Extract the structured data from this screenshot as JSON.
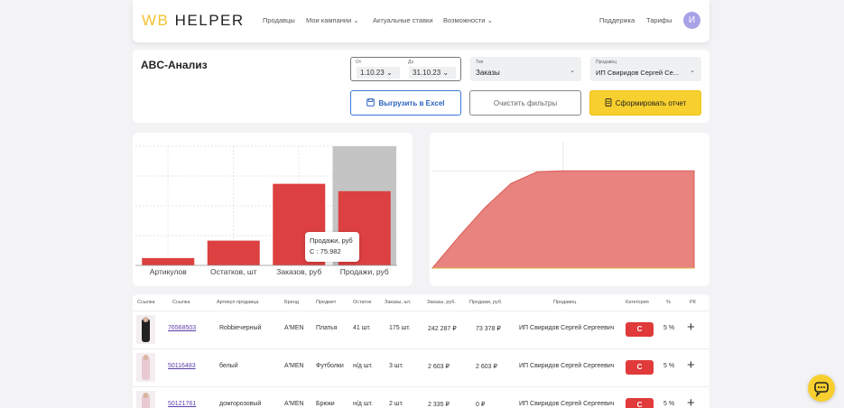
{
  "header": {
    "logo_wb": "WB",
    "logo_helper": "HELPER",
    "nav": [
      "Продавцы",
      "Мои кампании",
      "Актуальные ставки",
      "Возможности"
    ],
    "support": "Поддержка",
    "tariffs": "Тарифы",
    "avatar_letter": "И"
  },
  "filters": {
    "title": "ABC-Анализ",
    "date_from_label": "От",
    "date_from": "1.10.23",
    "date_to_label": "До",
    "date_to": "31.10.23",
    "type_label": "Тип",
    "type_value": "Заказы",
    "seller_label": "Продавец",
    "seller_value": "ИП Свиридов Сергей Се...",
    "excel_button": "Выгрузить в Excel",
    "clear_button": "Очистить фильтры",
    "report_button": "Сформировать отчет"
  },
  "chart_data": [
    {
      "type": "bar",
      "categories": [
        "Артикулов",
        "Остатков, шт",
        "Заказов, руб",
        "Продажи, руб"
      ],
      "values": [
        8,
        27,
        89,
        81
      ],
      "ylim": [
        0,
        130
      ],
      "grid": true,
      "tooltip": {
        "series": "Продажи, руб",
        "label": "C",
        "value": "75.982"
      }
    },
    {
      "type": "area",
      "x": [
        0,
        10,
        20,
        30,
        40,
        50,
        60,
        70,
        80,
        90,
        100
      ],
      "y": [
        0,
        32,
        62,
        87,
        99,
        100,
        100,
        100,
        100,
        100,
        100
      ],
      "ylim": [
        0,
        130
      ],
      "grid": true
    }
  ],
  "table": {
    "headers": [
      "Ссылка",
      "Ссылка",
      "Артикул продавца",
      "Бренд",
      "Предмет",
      "Остаток",
      "Заказы, шт.",
      "Заказы, руб.",
      "Продажи, руб.",
      "Продавец",
      "Категория",
      "%",
      "РК"
    ],
    "rows": [
      {
        "link": "76568503",
        "article": "Robbieчерный",
        "brand": "A'MEN",
        "subject": "Платья",
        "stock": "41 шт.",
        "orders_qty": "175 шт.",
        "orders_rub": "242 287 ₽",
        "sales_rub": "73 378 ₽",
        "seller": "ИП Свиридов Сергей Сергеевич",
        "category": "C",
        "percent": "5 %"
      },
      {
        "link": "50116483",
        "article": "белый",
        "brand": "A'MEN",
        "subject": "Футболки",
        "stock": "н/д шт.",
        "orders_qty": "3 шт.",
        "orders_rub": "2 603 ₽",
        "sales_rub": "2 603 ₽",
        "seller": "ИП Свиридов Сергей Сергеевич",
        "category": "C",
        "percent": "5 %"
      },
      {
        "link": "50121761",
        "article": "дожгорозовый",
        "brand": "A'MEN",
        "subject": "Брюки",
        "stock": "н/д шт.",
        "orders_qty": "2 шт.",
        "orders_rub": "2 335 ₽",
        "sales_rub": "0 ₽",
        "seller": "ИП Свиридов Сергей Сергеевич",
        "category": "C",
        "percent": "5 %"
      }
    ]
  },
  "colors": {
    "accent": "#f7cf2e",
    "bar": "#dc4040",
    "area": "#e8837f",
    "badge": "#e03a3a",
    "link": "#5a3ea8"
  }
}
